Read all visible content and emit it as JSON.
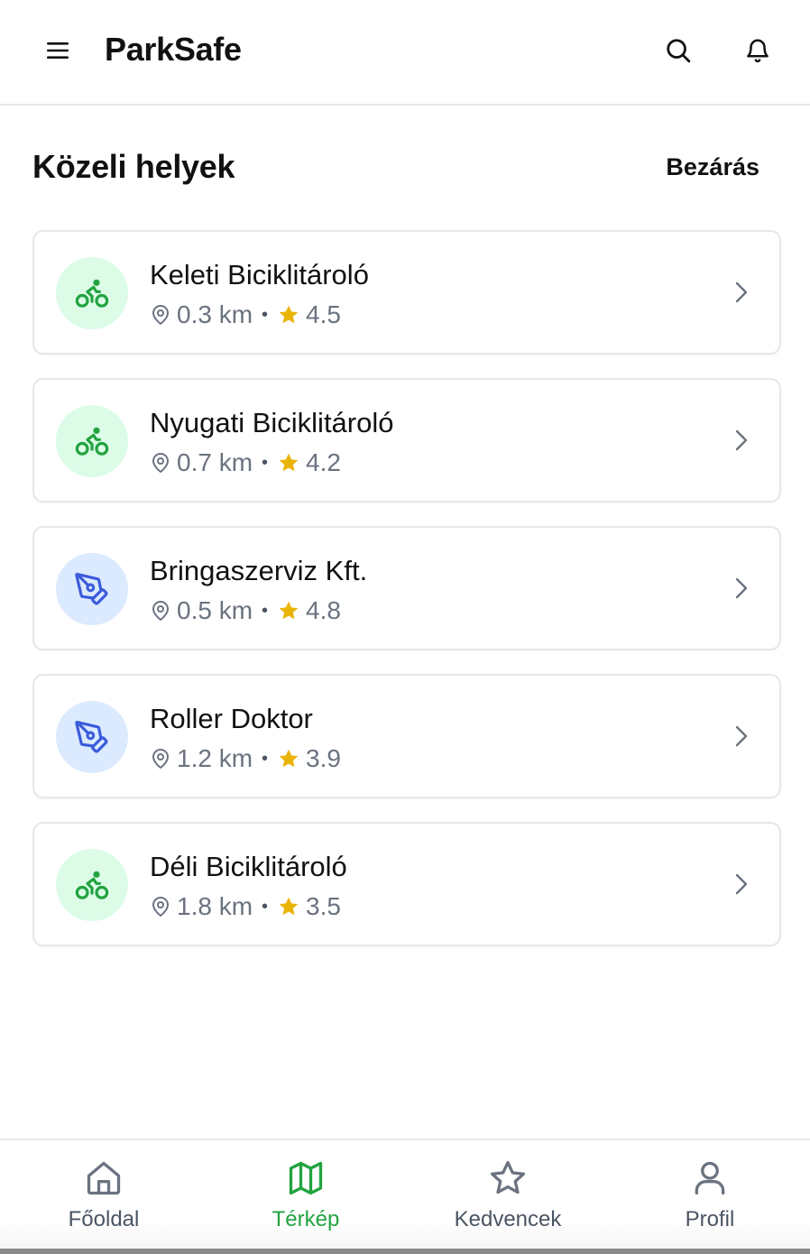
{
  "header": {
    "app_title": "ParkSafe",
    "menu_icon": "menu-icon",
    "search_icon": "search-icon",
    "bell_icon": "bell-icon"
  },
  "section": {
    "title": "Közeli helyek",
    "close_label": "Bezárás"
  },
  "places": [
    {
      "name": "Keleti Biciklitároló",
      "distance": "0.3 km",
      "rating": "4.5",
      "icon": "bike-icon",
      "color": "#22a33f"
    },
    {
      "name": "Nyugati Biciklitároló",
      "distance": "0.7 km",
      "rating": "4.2",
      "icon": "bike-icon",
      "color": "#22a33f"
    },
    {
      "name": "Bringaszerviz Kft.",
      "distance": "0.5 km",
      "rating": "4.8",
      "icon": "pen-tool-icon",
      "color": "#3b5bdb"
    },
    {
      "name": "Roller Doktor",
      "distance": "1.2 km",
      "rating": "3.9",
      "icon": "pen-tool-icon",
      "color": "#3b5bdb"
    },
    {
      "name": "Déli Biciklitároló",
      "distance": "1.8 km",
      "rating": "3.5",
      "icon": "bike-icon",
      "color": "#22a33f"
    }
  ],
  "meta_separator": "•",
  "colors": {
    "accent_green": "#22a33f",
    "star": "#eab308",
    "muted": "#6b7280",
    "border": "#e5e7eb"
  },
  "nav": {
    "items": [
      {
        "label": "Főoldal",
        "icon": "home-icon",
        "active": false
      },
      {
        "label": "Térkép",
        "icon": "map-icon",
        "active": true
      },
      {
        "label": "Kedvencek",
        "icon": "star-icon",
        "active": false
      },
      {
        "label": "Profil",
        "icon": "user-icon",
        "active": false
      }
    ]
  }
}
